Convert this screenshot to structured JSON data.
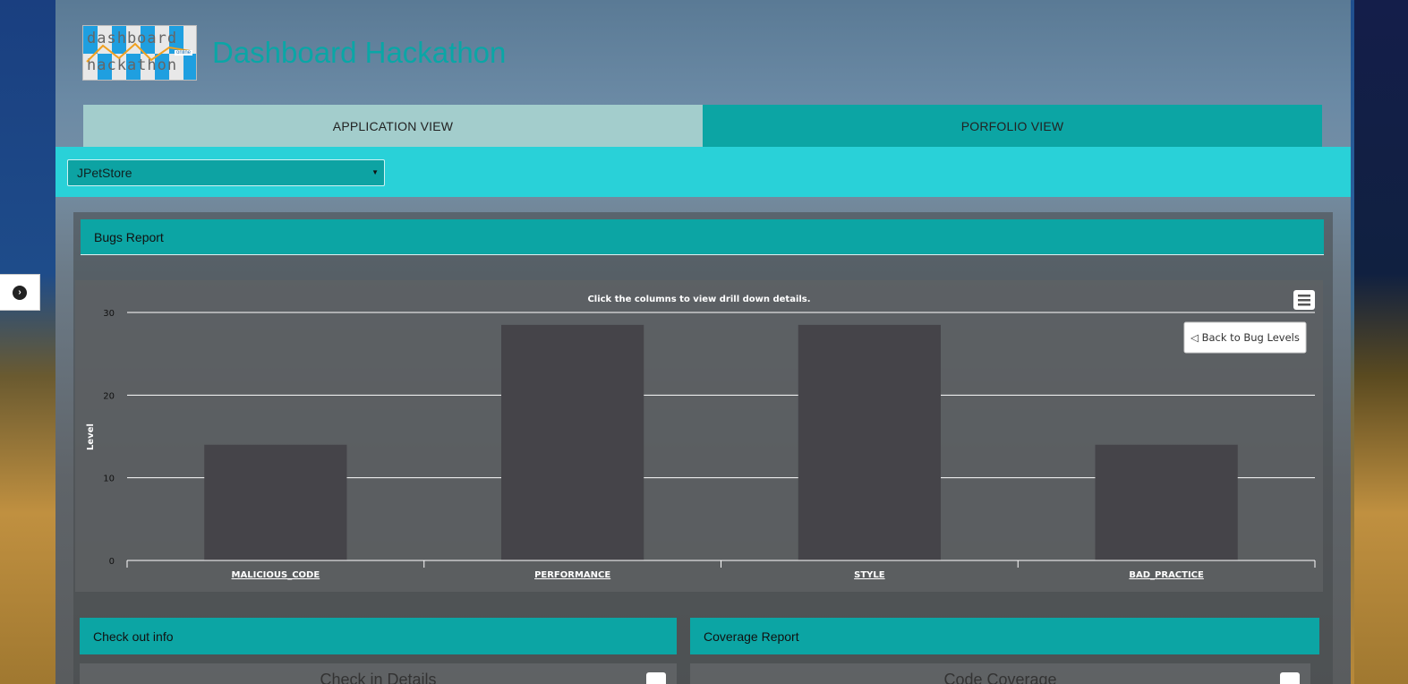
{
  "app": {
    "title": "Dashboard Hackathon",
    "logo": {
      "line1": "dashboard",
      "line2": "hackathon",
      "badge": "online"
    }
  },
  "tabs": [
    {
      "label": "APPLICATION VIEW",
      "active": true
    },
    {
      "label": "PORFOLIO VIEW",
      "active": false
    }
  ],
  "filter": {
    "selected": "JPetStore"
  },
  "bugs": {
    "title": "Bugs Report",
    "back_button": "◁ Back to Bug Levels"
  },
  "panels": {
    "checkout": {
      "title": "Check out info",
      "subtitle": "Check in Details"
    },
    "coverage": {
      "title": "Coverage Report",
      "subtitle": "Code Coverage"
    }
  },
  "icons": {
    "side_toggle": "chevron-right-circle-icon",
    "chart_menu": "hamburger-menu-icon"
  },
  "colors": {
    "accent": "#0ca5a4",
    "filter_bar": "#29d1d8",
    "active_tab": "#a3cdcc",
    "bar": "#454449",
    "title_text": "#0aa6a6"
  },
  "chart_data": {
    "type": "bar",
    "subtitle": "Click the columns to view drill down details.",
    "ylabel": "Level",
    "categories": [
      "MALICIOUS_CODE",
      "PERFORMANCE",
      "STYLE",
      "BAD_PRACTICE"
    ],
    "values": [
      14,
      28.5,
      28.5,
      14
    ],
    "ylim": [
      0,
      30
    ],
    "yticks": [
      0,
      10,
      20,
      30
    ],
    "grid": true
  }
}
